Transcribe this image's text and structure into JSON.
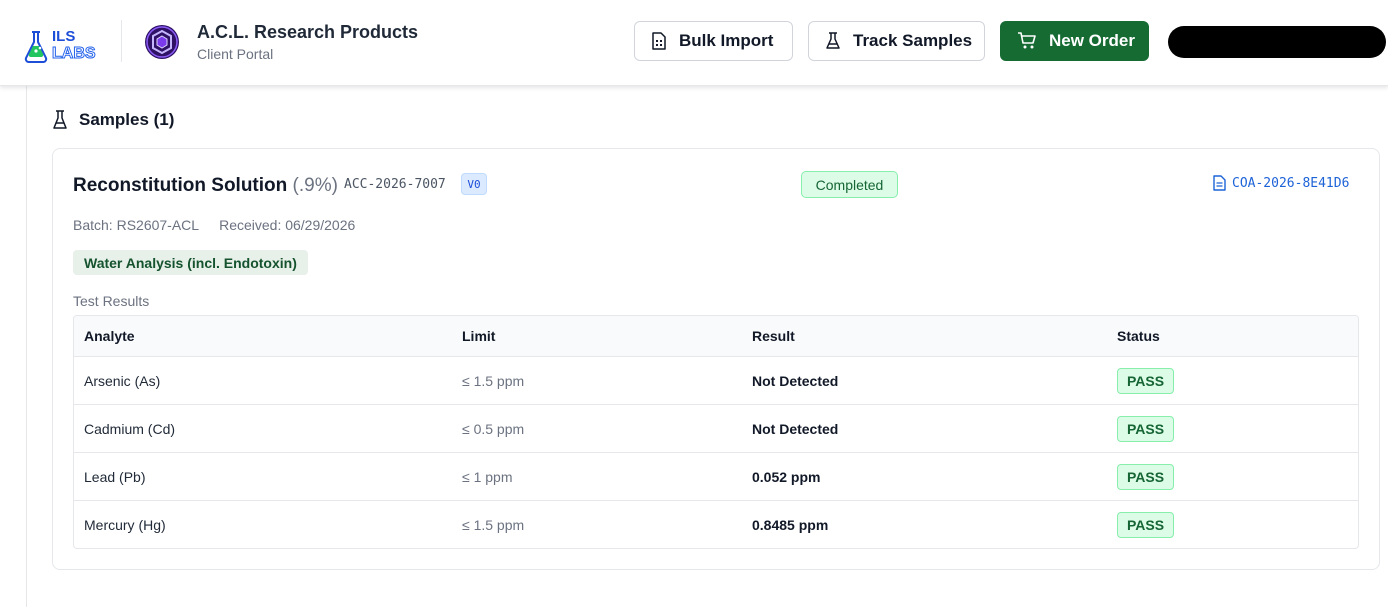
{
  "header": {
    "logo_text_top": "ILS",
    "logo_text_bottom": "LABS",
    "client_name": "A.C.L. Research Products",
    "client_subtitle": "Client Portal",
    "bulk_import_label": "Bulk Import",
    "track_samples_label": "Track Samples",
    "new_order_label": "New Order"
  },
  "colors": {
    "brand_green": "#166b33",
    "pass_green_bg": "#dcfce7",
    "link_blue": "#1d63d8"
  },
  "samples": {
    "title": "Samples (1)"
  },
  "sample": {
    "name": "Reconstitution Solution",
    "concentration": "(.9%)",
    "accession": "ACC-2026-7007",
    "version": "V0",
    "status": "Completed",
    "coa_id": "COA-2026-8E41D6",
    "batch": "Batch: RS2607-ACL",
    "received": "Received: 06/29/2026",
    "test_name": "Water Analysis (incl. Endotoxin)",
    "results_label": "Test Results"
  },
  "table": {
    "headers": [
      "Analyte",
      "Limit",
      "Result",
      "Status"
    ],
    "rows": [
      {
        "analyte": "Arsenic (As)",
        "limit": "≤ 1.5 ppm",
        "result": "Not Detected",
        "status": "PASS"
      },
      {
        "analyte": "Cadmium (Cd)",
        "limit": "≤ 0.5 ppm",
        "result": "Not Detected",
        "status": "PASS"
      },
      {
        "analyte": "Lead (Pb)",
        "limit": "≤ 1 ppm",
        "result": "0.052 ppm",
        "status": "PASS"
      },
      {
        "analyte": "Mercury (Hg)",
        "limit": "≤ 1.5 ppm",
        "result": "0.8485 ppm",
        "status": "PASS"
      }
    ]
  }
}
